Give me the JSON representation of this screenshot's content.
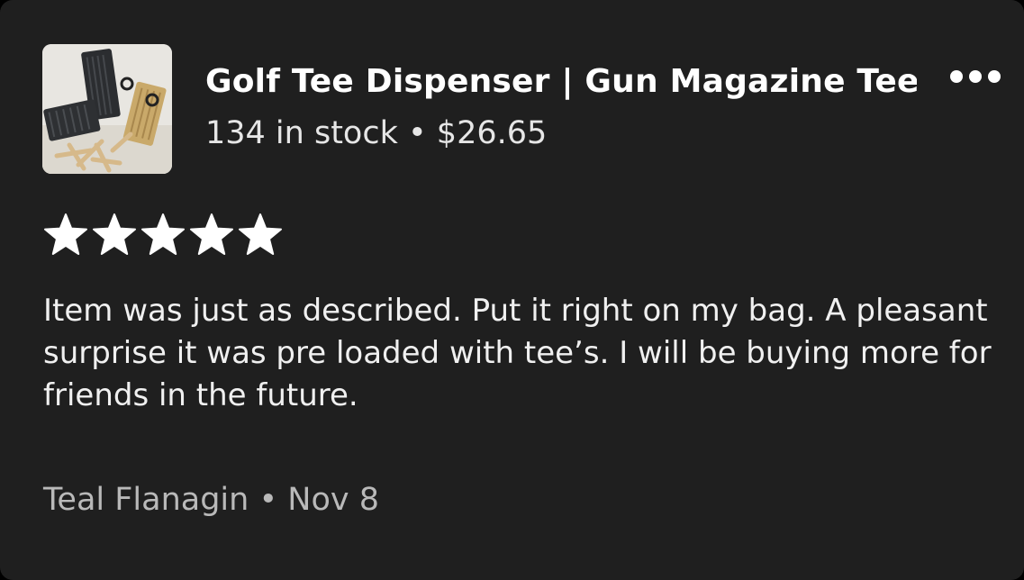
{
  "listing": {
    "title": "Golf Tee Dispenser | Gun Magazine Tee...",
    "stock": "134 in stock",
    "separator": "•",
    "price": "$26.65",
    "thumbnail_icon": "product-photo"
  },
  "menu": {
    "icon": "more-horizontal-icon"
  },
  "rating": {
    "value": 5,
    "max": 5,
    "icon": "star-icon",
    "color": "#ffffff"
  },
  "review": {
    "text": "Item was just as described. Put it right on my bag. A pleasant surprise it was pre loaded with tee’s. I will be buying more for friends in the future."
  },
  "author": {
    "name": "Teal Flanagin",
    "separator": "•",
    "date": "Nov 8"
  },
  "colors": {
    "card_background": "#1f1f1f",
    "primary_text": "#ffffff",
    "secondary_text": "#b9b9b9"
  }
}
